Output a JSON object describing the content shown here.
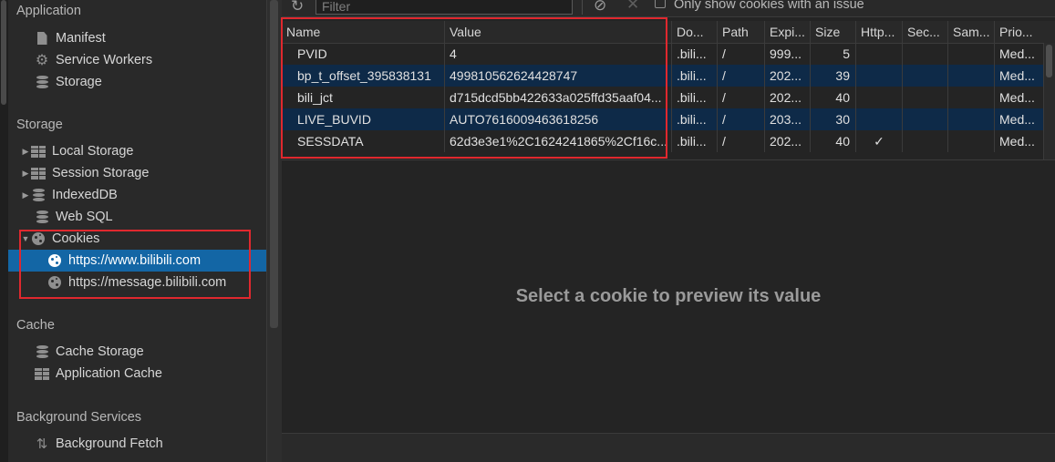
{
  "sidebar": {
    "sections": {
      "application": "Application",
      "storage": "Storage",
      "cache": "Cache",
      "background_services": "Background Services"
    },
    "application_items": [
      {
        "label": "Manifest",
        "icon": "document-icon"
      },
      {
        "label": "Service Workers",
        "icon": "gear-icon"
      },
      {
        "label": "Storage",
        "icon": "database-icon"
      }
    ],
    "storage_items": [
      {
        "label": "Local Storage",
        "icon": "grid-icon"
      },
      {
        "label": "Session Storage",
        "icon": "grid-icon"
      },
      {
        "label": "IndexedDB",
        "icon": "database-icon"
      },
      {
        "label": "Web SQL",
        "icon": "database-icon"
      },
      {
        "label": "Cookies",
        "icon": "cookie-icon"
      }
    ],
    "cookie_origins": [
      {
        "label": "https://www.bilibili.com",
        "selected": true
      },
      {
        "label": "https://message.bilibili.com",
        "selected": false
      }
    ],
    "cache_items": [
      {
        "label": "Cache Storage",
        "icon": "database-icon"
      },
      {
        "label": "Application Cache",
        "icon": "grid-icon"
      }
    ],
    "background_items": [
      {
        "label": "Background Fetch",
        "icon": "arrows-icon"
      }
    ]
  },
  "toolbar": {
    "filter_placeholder": "Filter",
    "only_issues_label": "Only show cookies with an issue",
    "only_issues_checked": false
  },
  "table": {
    "columns": [
      "Name",
      "Value",
      "Do...",
      "Path",
      "Expi...",
      "Size",
      "Http...",
      "Sec...",
      "Sam...",
      "Prio..."
    ],
    "rows": [
      [
        "PVID",
        "4",
        ".bili...",
        "/",
        "999...",
        "5",
        "",
        "",
        "",
        "Med..."
      ],
      [
        "bp_t_offset_395838131",
        "499810562624428747",
        ".bili...",
        "/",
        "202...",
        "39",
        "",
        "",
        "",
        "Med..."
      ],
      [
        "bili_jct",
        "d715dcd5bb422633a025ffd35aaf04...",
        ".bili...",
        "/",
        "202...",
        "40",
        "",
        "",
        "",
        "Med..."
      ],
      [
        "LIVE_BUVID",
        "AUTO7616009463618256",
        ".bili...",
        "/",
        "203...",
        "30",
        "",
        "",
        "",
        "Med..."
      ],
      [
        "SESSDATA",
        "62d3e3e1%2C1624241865%2Cf16c...",
        ".bili...",
        "/",
        "202...",
        "40",
        "✓",
        "",
        "",
        "Med..."
      ]
    ]
  },
  "preview": {
    "message": "Select a cookie to preview its value"
  },
  "colors": {
    "selected_bg": "#1366a5",
    "alt_row_bg": "#0e2a48",
    "annotation_red": "#e0282e"
  }
}
